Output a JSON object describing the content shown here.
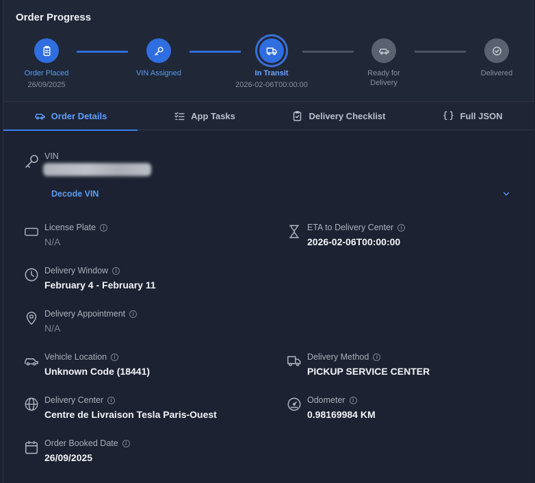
{
  "header": {
    "title": "Order Progress"
  },
  "stepper": {
    "steps": [
      {
        "label": "Order Placed",
        "date": "26/09/2025",
        "status": "done",
        "icon": "clipboard-icon"
      },
      {
        "label": "VIN Assigned",
        "date": "",
        "status": "done",
        "icon": "key-icon"
      },
      {
        "label": "In Transit",
        "date": "2026-02-06T00:00:00",
        "status": "current",
        "icon": "truck-icon"
      },
      {
        "label": "Ready for Delivery",
        "date": "",
        "status": "pending",
        "icon": "car-icon"
      },
      {
        "label": "Delivered",
        "date": "",
        "status": "pending",
        "icon": "check-circle-icon"
      }
    ]
  },
  "tabs": [
    {
      "label": "Order Details",
      "icon": "car-icon",
      "active": true
    },
    {
      "label": "App Tasks",
      "icon": "list-check-icon",
      "active": false
    },
    {
      "label": "Delivery Checklist",
      "icon": "clipboard-check-icon",
      "active": false
    },
    {
      "label": "Full JSON",
      "icon": "braces-icon",
      "active": false
    }
  ],
  "details": {
    "vin": {
      "label": "VIN",
      "decode_label": "Decode VIN"
    },
    "license_plate": {
      "label": "License Plate",
      "value": "N/A"
    },
    "eta": {
      "label": "ETA to Delivery Center",
      "value": "2026-02-06T00:00:00"
    },
    "delivery_window": {
      "label": "Delivery Window",
      "value": "February 4 - February 11"
    },
    "delivery_appointment": {
      "label": "Delivery Appointment",
      "value": "N/A"
    },
    "vehicle_location": {
      "label": "Vehicle Location",
      "value": "Unknown Code (18441)"
    },
    "delivery_method": {
      "label": "Delivery Method",
      "value": "PICKUP SERVICE CENTER"
    },
    "delivery_center": {
      "label": "Delivery Center",
      "value": "Centre de Livraison Tesla Paris-Ouest"
    },
    "odometer": {
      "label": "Odometer",
      "value": "0.98169984 KM"
    },
    "order_booked_date": {
      "label": "Order Booked Date",
      "value": "26/09/2025"
    }
  },
  "colors": {
    "accent": "#2f6ee0",
    "accent_text": "#5b9bf2",
    "pending": "#5a6170",
    "background": "#1c2231"
  }
}
